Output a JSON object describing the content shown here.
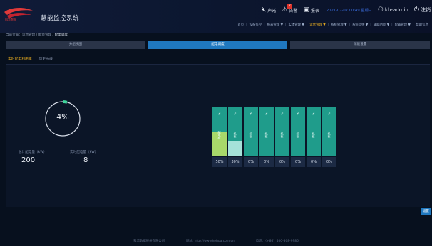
{
  "header": {
    "title": "慧能监控系统",
    "tools": {
      "sound_label": "声光",
      "alarm_label": "告警",
      "alarm_count": "2",
      "notice_label": "报表",
      "datetime": "2021-07-07 00:49 星期三",
      "user": "kh-admin",
      "logout_label": "注销"
    },
    "menu": [
      "首页",
      "设备监控",
      "报表管理 ▼",
      "实体管理 ▼",
      "运营管理 ▼",
      "系统管理 ▼",
      "系统运维 ▼",
      "辅助功能 ▼",
      "配置管理 ▼",
      "帮助信息"
    ],
    "menu_active_index": 4,
    "accent_color": "#f4b521"
  },
  "breadcrumb": {
    "prefix": "当前位置：运营管理 / 能量管理 / ",
    "current": "配电调度"
  },
  "tabs": [
    "分组视图",
    "配电调度",
    "储能设置"
  ],
  "tabs_active_index": 1,
  "subtabs": [
    "实时配电利用率",
    "历史曲线"
  ],
  "subtabs_active_index": 0,
  "gauge": {
    "value_text": "4%",
    "percent": 4,
    "color": "#3fd69b",
    "track_color": "#d7dde8"
  },
  "stats": {
    "total_label": "总计配电量（kW）",
    "total_value": "200",
    "realtime_label": "实时配电量（kW）",
    "realtime_value": "8"
  },
  "cells": [
    {
      "icon": "⚡",
      "text": "配电柜",
      "fill": 0.5,
      "fill_color": "#a8d86a",
      "pct": "50%"
    },
    {
      "icon": "⚡",
      "text": "机柜",
      "fill": 0.3,
      "fill_color": "#a5e2d9",
      "pct": "30%"
    },
    {
      "icon": "⚡",
      "text": "机柜",
      "fill": 0,
      "fill_color": "#1f9c8b",
      "pct": "0%"
    },
    {
      "icon": "⚡",
      "text": "机柜",
      "fill": 0,
      "fill_color": "#1f9c8b",
      "pct": "0%"
    },
    {
      "icon": "⚡",
      "text": "机柜",
      "fill": 0,
      "fill_color": "#1f9c8b",
      "pct": "0%"
    },
    {
      "icon": "⚡",
      "text": "机柜",
      "fill": 0,
      "fill_color": "#1f9c8b",
      "pct": "0%"
    },
    {
      "icon": "⚡",
      "text": "机柜",
      "fill": 0,
      "fill_color": "#1f9c8b",
      "pct": "0%"
    },
    {
      "icon": "⚡",
      "text": "机柜",
      "fill": 0,
      "fill_color": "#1f9c8b",
      "pct": "0%"
    }
  ],
  "settings_button": "设置",
  "footer": {
    "company": "科华数据股份有限公司",
    "website": "网址: http://www.kehua.com.cn",
    "phone": "电话：（+86）400-808-9986"
  }
}
